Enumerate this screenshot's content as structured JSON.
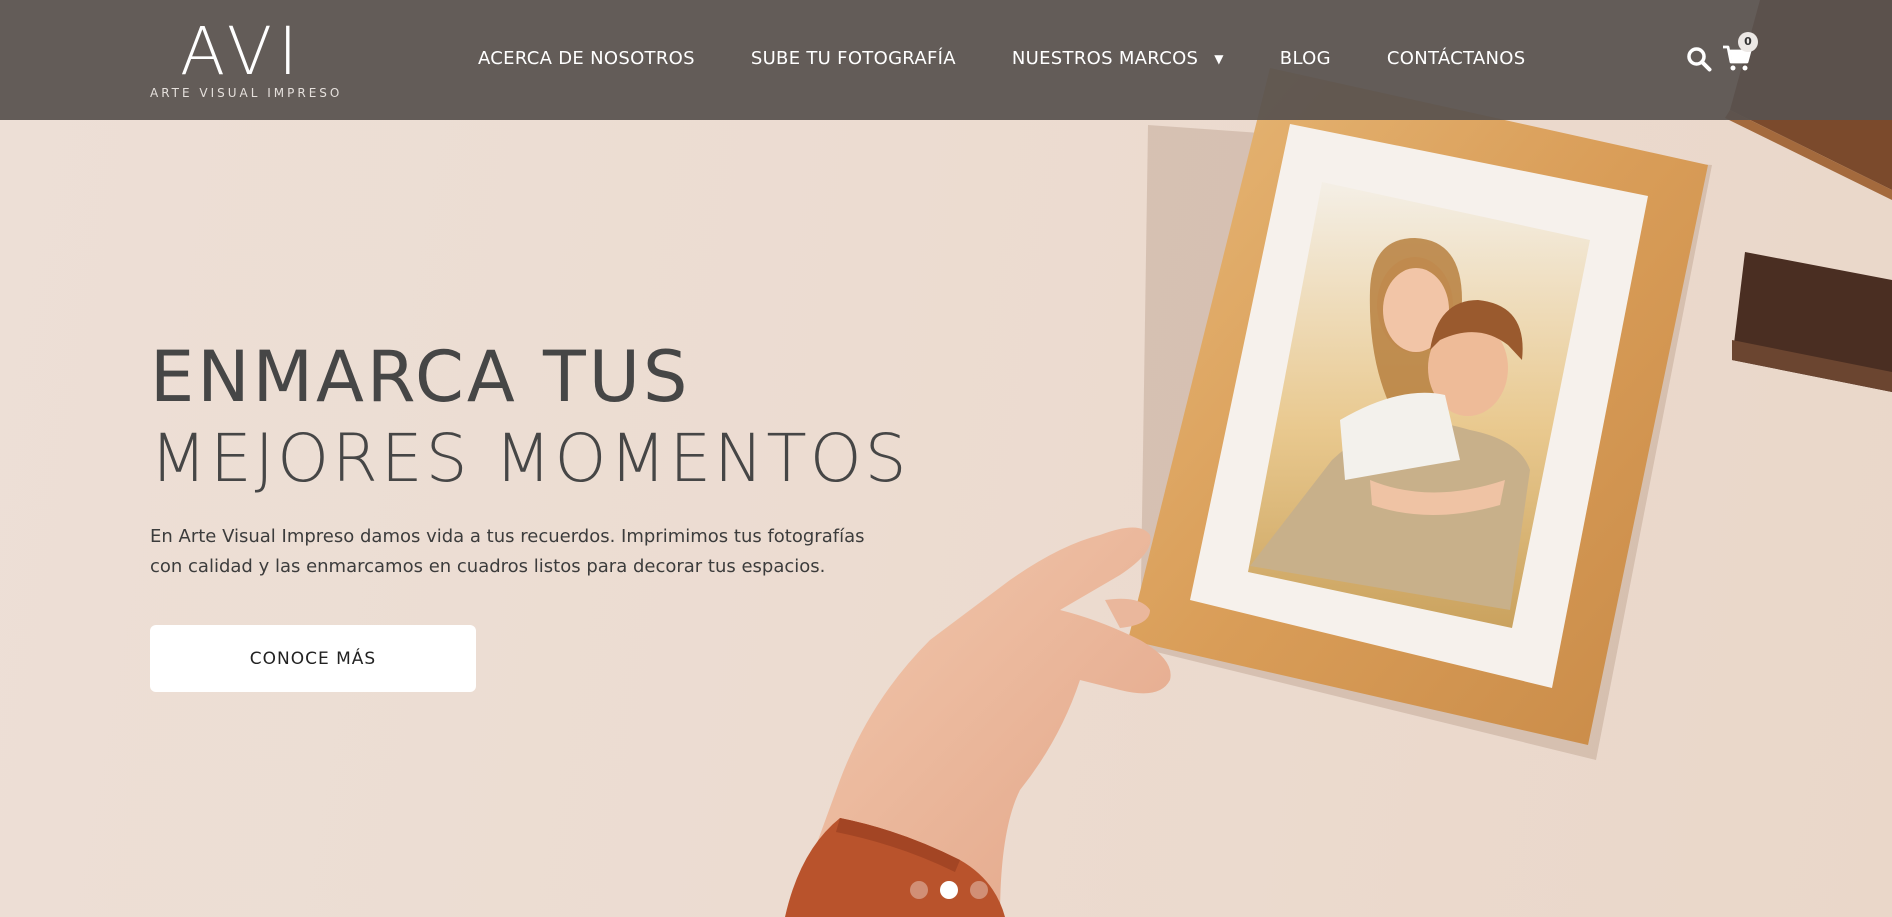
{
  "brand": {
    "logo_text": "AVI",
    "tagline": "ARTE VISUAL IMPRESO"
  },
  "nav": {
    "items": [
      {
        "label": "ACERCA DE NOSOTROS"
      },
      {
        "label": "SUBE TU FOTOGRAFÍA"
      },
      {
        "label": "NUESTROS MARCOS",
        "has_dropdown": true
      },
      {
        "label": "BLOG"
      },
      {
        "label": "CONTÁCTANOS"
      }
    ],
    "search_icon": "search-icon",
    "cart_icon": "cart-icon",
    "cart_count": "0"
  },
  "hero": {
    "headline_line1": "ENMARCA TUS",
    "headline_line2": "MEJORES MOMENTOS",
    "description": "En Arte Visual Impreso damos vida a tus recuerdos. Imprimimos tus fotografías con calidad y las enmarcamos en cuadros listos para decorar tus espacios.",
    "cta_label": "CONOCE MÁS",
    "image_subject": "hand holding wooden picture frame with photo of smiling couple"
  },
  "slider": {
    "slide_count": 3,
    "active_index": 1
  },
  "colors": {
    "header_bg": "#58524f",
    "hero_bg": "#eddfd6",
    "headline": "#464646",
    "button_bg": "#ffffff",
    "frame_wood": "#d9a15f"
  }
}
